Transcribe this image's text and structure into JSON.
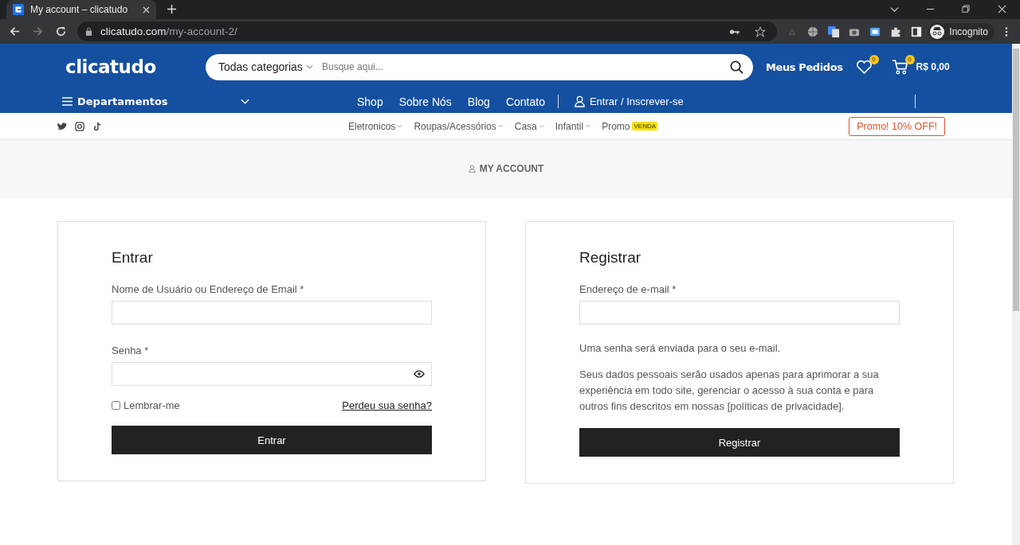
{
  "browser": {
    "tab_title": "My account – clicatudo",
    "url_host": "clicatudo.com",
    "url_path": "/my-account-2/",
    "profile_label": "Incognito"
  },
  "header": {
    "logo": "clicatudo",
    "category_select": "Todas categorias",
    "search_placeholder": "Busque aqui...",
    "orders_link": "Meus Pedidos",
    "wishlist_count": "0",
    "cart_count": "0",
    "cart_total": "R$ 0,00"
  },
  "nav": {
    "departments": "Departamentos",
    "links": [
      "Shop",
      "Sobre Nós",
      "Blog",
      "Contato"
    ],
    "account_link": "Entrar / Inscrever-se"
  },
  "subnav": {
    "categories": [
      {
        "label": "Eletronicos",
        "kind": "dropdown"
      },
      {
        "label": "Roupas/Acessórios",
        "kind": "dropdown"
      },
      {
        "label": "Casa",
        "kind": "dropdown"
      },
      {
        "label": "Infantil",
        "kind": "dropdown"
      },
      {
        "label": "Promo",
        "kind": "badge",
        "badge": "VENDA"
      }
    ],
    "promo_button": "Promo! 10% OFF!"
  },
  "page_title": "MY ACCOUNT",
  "login": {
    "title": "Entrar",
    "fields": [
      {
        "label": "Nome de Usuário ou Endereço de Email *",
        "kind": "text"
      },
      {
        "label": "Senha *",
        "kind": "password"
      }
    ],
    "remember": {
      "label": "Lembrar-me",
      "checked": false
    },
    "forgot_link": "Perdeu sua senha?",
    "button": "Entrar"
  },
  "register": {
    "title": "Registrar",
    "field_label": "Endereço de e-mail *",
    "note": "Uma senha será enviada para o seu e-mail.",
    "privacy": "Seus dados pessoais serão usados apenas para aprimorar a sua experiência em todo site, gerenciar o acesso à sua conta e para outros fins descritos em nossas [políticas de privacidade].",
    "button": "Registrar"
  }
}
